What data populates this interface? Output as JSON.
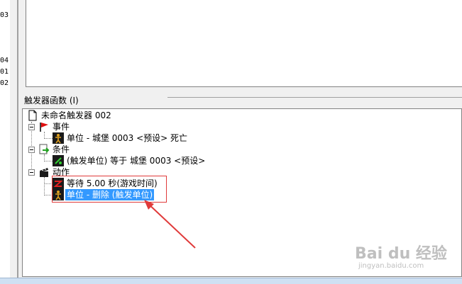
{
  "left_numbers": [
    "03",
    "04",
    "01",
    "02"
  ],
  "section": {
    "title": "触发器函数 (I)"
  },
  "tree": {
    "root": "未命名触发器 002",
    "event_group": "事件",
    "event_item": "单位 - 城堡 0003 <预设> 死亡",
    "condition_group": "条件",
    "condition_item": "(触发单位) 等于 城堡 0003 <预设>",
    "action_group": "动作",
    "action_item_1": "等待 5.00 秒(游戏时间)",
    "action_item_2": "单位 - 删除 (触发单位)"
  },
  "watermark": {
    "text": "Bai du 经验",
    "sub": "jingyan.baidu.com"
  },
  "colors": {
    "selection": "#3399ff",
    "annotation": "#e03a3a"
  }
}
